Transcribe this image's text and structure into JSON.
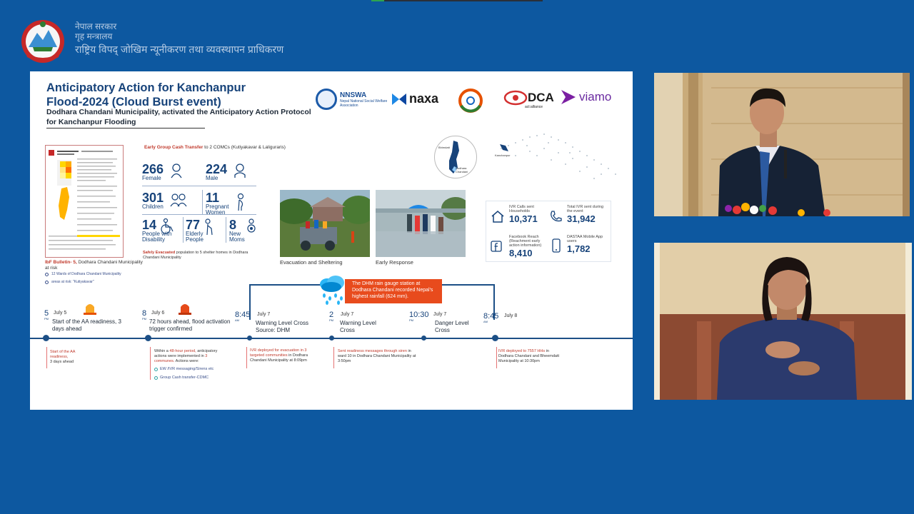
{
  "header": {
    "line1": "नेपाल सरकार",
    "line2": "गृह मन्त्रालय",
    "line3": "राष्ट्रिय विपद् जोखिम न्यूनीकरण तथा व्यवस्थापन प्राधिकरण"
  },
  "slide": {
    "title": "Anticipatory Action for Kanchanpur Flood-2024 (Cloud Burst event)",
    "subtitle": "Dodhara Chandani Municipality, activated the Anticipatory Action Protocol for Kanchanpur Flooding",
    "logos": {
      "nnswa": "NNSWA",
      "nnswa_full": "Nepal National Social Welfare Association",
      "naxa": "naxa",
      "dca": "DCA",
      "dca_sub": "act:alliance",
      "viamo": "viamo"
    },
    "bulletin": {
      "caption_label": "IbF Bulletin- 5,",
      "caption_rest": " Dodhara Chandani Municipality at risk",
      "items": [
        "12 Wards of Dodhara Chandani Municipality",
        "areas at risk: \"Kutiyakavar\""
      ]
    },
    "cash": {
      "label": "Early Group Cash Transfer",
      "rest": " to 2 COMCs (Kutiyakavar & Laliguraris)"
    },
    "stats": [
      {
        "n": "266",
        "l": "Female"
      },
      {
        "n": "224",
        "l": "Male"
      },
      {
        "n": "301",
        "l": "Children"
      },
      {
        "n": "11",
        "l": "Pregnant Women"
      },
      {
        "n": "14",
        "l": "People with Disability"
      },
      {
        "n": "77",
        "l": "Elderly People"
      },
      {
        "n": "8",
        "l": "New Moms"
      }
    ],
    "evac": {
      "label": "Safely Evacuated",
      "rest": " population to 5 shelter homes in Dodhara Chandani Municipality"
    },
    "photos": [
      {
        "caption": "Evacuation and Sheltering"
      },
      {
        "caption": "Early Response"
      }
    ],
    "map": {
      "label1": "Bhimdatt",
      "label2": "Dodhara Chandani",
      "label3": "Kanchanpur"
    },
    "ivr": [
      {
        "small": "IVR Calls sent Households",
        "num": "10,371",
        "icon": "home-icon"
      },
      {
        "small": "Total IVR sent during the event",
        "num": "31,942",
        "icon": "phone-icon"
      },
      {
        "small": "Facebook Reach (Reachment early action information)",
        "num": "8,410",
        "icon": "facebook-icon"
      },
      {
        "small": "DASTAA Mobile App users",
        "num": "1,782",
        "icon": "mobile-icon"
      }
    ],
    "alert": "The DHM rain gauge station at Dodhara Chandani recorded Nepal's highest rainfall (624 mm).",
    "timeline": [
      {
        "time": "5",
        "ap": "PM",
        "date": "July 5",
        "desc": "Start of the AA readiness, 3 days ahead"
      },
      {
        "time": "8",
        "ap": "PM",
        "date": "July 6",
        "desc": "72 hours ahead, flood activation trigger confirmed"
      },
      {
        "time": "8:45",
        "ap": "AM",
        "date": "July 7",
        "desc": "Warning Level Cross Source: DHM"
      },
      {
        "time": "2",
        "ap": "PM",
        "date": "July 7",
        "desc": "Warning Level Cross"
      },
      {
        "time": "10:30",
        "ap": "PM",
        "date": "July 7",
        "desc": "Danger Level Cross"
      },
      {
        "time": "8:45",
        "ap": "AM",
        "date": "July 8",
        "desc": ""
      }
    ],
    "notes": {
      "n1_red": "Start of the AA readiness,",
      "n1_rest": "3 days ahead",
      "n2_a": "Within a ",
      "n2_red": "48-hour period,",
      "n2_b": " anticipatory actions were implemented in ",
      "n2_red2": "3 communes.",
      "n2_c": " Actions were:",
      "n2_sub1": "EW /IVR messaging/Sirens etc",
      "n2_sub2": "Group Cash transfer-CDMC",
      "n3_red": "IVR deployed for evacuation in 3 targeted communities",
      "n3_rest": " in Dodhara Chandani Municipality at 8:09pm",
      "n4_red": "Sent readiness messages through siren",
      "n4_rest": " in ward 10 in Dodhara Chandani Municipality at 3:50pm",
      "n5_red": "IVR deployed to 7557 HHs",
      "n5_rest": " in Dodhara Chandani and Bheemdatt Municipality at 10:30pm"
    }
  },
  "colors": {
    "background": "#0d58a0",
    "title": "#17437a",
    "accent_red": "#e84b1d"
  }
}
